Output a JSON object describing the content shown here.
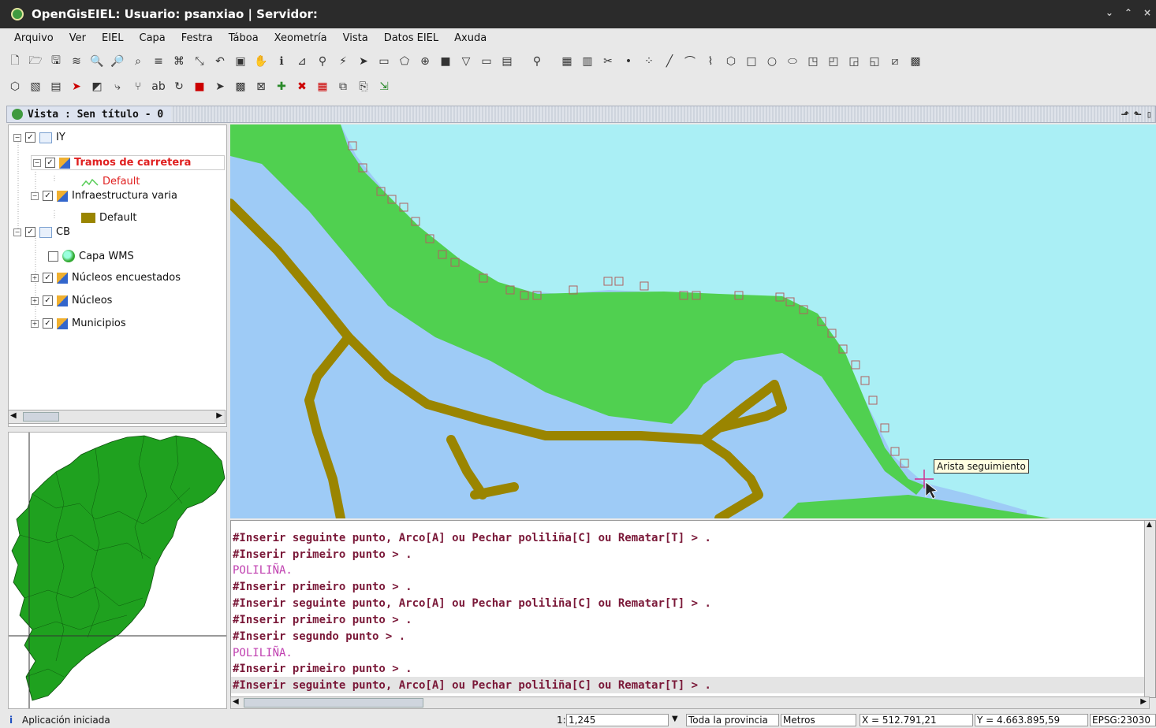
{
  "window": {
    "title": "OpenGisEIEL: Usuario: psanxiao | Servidor:",
    "controls": [
      "⌄",
      "⌃",
      "×"
    ]
  },
  "menubar": [
    "Arquivo",
    "Ver",
    "EIEL",
    "Capa",
    "Festra",
    "Táboa",
    "Xeometría",
    "Vista",
    "Datos EIEL",
    "Axuda"
  ],
  "view": {
    "title": "Vista : Sen título - 0"
  },
  "toc": {
    "items": [
      {
        "label": "IY"
      },
      {
        "label": "Tramos de carretera"
      },
      {
        "label": "Default"
      },
      {
        "label": "Infraestructura varia"
      },
      {
        "label": "Default"
      },
      {
        "label": "CB"
      },
      {
        "label": "Capa WMS"
      },
      {
        "label": "Núcleos encuestados"
      },
      {
        "label": "Núcleos"
      },
      {
        "label": "Municipios"
      }
    ]
  },
  "map": {
    "tooltip": "Arista seguimiento",
    "colors": {
      "sea": "#aaeff5",
      "land": "#50d050",
      "water": "#9ecbf6",
      "road": "#9a8500"
    }
  },
  "console": {
    "lines": [
      {
        "text": "#Inserir seguinte punto, Arco[A] ou Pechar poliliña[C] ou Rematar[T] > ."
      },
      {
        "text": "#Inserir primeiro punto > ."
      },
      {
        "text": "POLILIÑA."
      },
      {
        "text": "#Inserir primeiro punto > ."
      },
      {
        "text": "#Inserir seguinte punto, Arco[A] ou Pechar poliliña[C] ou Rematar[T] > ."
      },
      {
        "text": "#Inserir primeiro punto > ."
      },
      {
        "text": "#Inserir segundo punto > ."
      },
      {
        "text": "POLILIÑA."
      },
      {
        "text": "#Inserir primeiro punto > ."
      },
      {
        "text": "#Inserir seguinte punto, Arco[A] ou Pechar poliliña[C] ou Rematar[T] > ."
      }
    ]
  },
  "status": {
    "message": "Aplicación iniciada",
    "scale_prefix": "1:",
    "scale_value": "1,245",
    "region": "Toda la provincia",
    "units": "Metros",
    "x": "X = 512.791,21",
    "y": "Y = 4.663.895,59",
    "crs": "EPSG:23030"
  }
}
